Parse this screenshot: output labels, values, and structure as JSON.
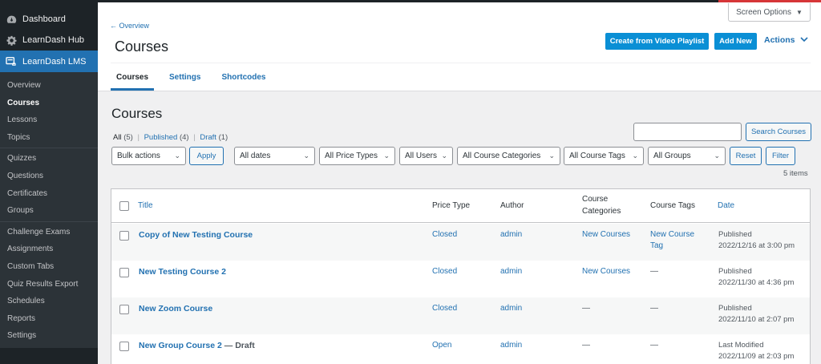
{
  "sidebar": {
    "top_items": [
      {
        "label": "Dashboard",
        "icon": "dashboard-icon"
      },
      {
        "label": "LearnDash Hub",
        "icon": "gear-icon"
      },
      {
        "label": "LearnDash LMS",
        "icon": "learndash-icon"
      }
    ],
    "submenu": [
      "Overview",
      "Courses",
      "Lessons",
      "Topics",
      "Quizzes",
      "Questions",
      "Certificates",
      "Groups",
      "Challenge Exams",
      "Assignments",
      "Custom Tabs",
      "Quiz Results Export",
      "Schedules",
      "Reports",
      "Settings"
    ],
    "current": "Courses"
  },
  "header": {
    "screen_options": "Screen Options",
    "back_link": "← Overview",
    "title": "Courses",
    "create_video_button": "Create from Video Playlist",
    "add_new_button": "Add New",
    "actions_label": "Actions",
    "tabs": [
      "Courses",
      "Settings",
      "Shortcodes"
    ]
  },
  "list": {
    "heading": "Courses",
    "views": {
      "all": "All",
      "all_count": "(5)",
      "published": "Published",
      "published_count": "(4)",
      "draft": "Draft",
      "draft_count": "(1)",
      "sep": "|"
    },
    "search_button": "Search Courses",
    "search_value": "",
    "bulk_actions": "Bulk actions",
    "apply": "Apply",
    "filters": [
      "All dates",
      "All Price Types",
      "All Users",
      "All Course Categories",
      "All Course Tags",
      "All Groups"
    ],
    "reset": "Reset",
    "filter": "Filter",
    "items_count": "5 items"
  },
  "table": {
    "columns": {
      "title": "Title",
      "price_type": "Price Type",
      "author": "Author",
      "categories_1": "Course",
      "categories_2": "Categories",
      "tags": "Course Tags",
      "date": "Date"
    },
    "rows": [
      {
        "title": "Copy of New Testing Course",
        "state": "",
        "price": "Closed",
        "author": "admin",
        "category": "New Courses",
        "tag1": "New Course",
        "tag2": "Tag",
        "date_status": "Published",
        "date": "2022/12/16 at 3:00 pm"
      },
      {
        "title": "New Testing Course 2",
        "state": "",
        "price": "Closed",
        "author": "admin",
        "category": "New Courses",
        "tag1": "—",
        "tag2": "",
        "date_status": "Published",
        "date": "2022/11/30 at 4:36 pm"
      },
      {
        "title": "New Zoom Course",
        "state": "",
        "price": "Closed",
        "author": "admin",
        "category": "—",
        "tag1": "—",
        "tag2": "",
        "date_status": "Published",
        "date": "2022/11/10 at 2:07 pm"
      },
      {
        "title": "New Group Course 2",
        "state": " — Draft",
        "price": "Open",
        "author": "admin",
        "category": "—",
        "tag1": "—",
        "tag2": "",
        "date_status": "Last Modified",
        "date": "2022/11/09 at 2:03 pm"
      }
    ]
  },
  "colors": {
    "accent": "#2271b1",
    "button": "#0a8fd5",
    "sidebar": "#1d2327",
    "active": "#2271b1"
  }
}
